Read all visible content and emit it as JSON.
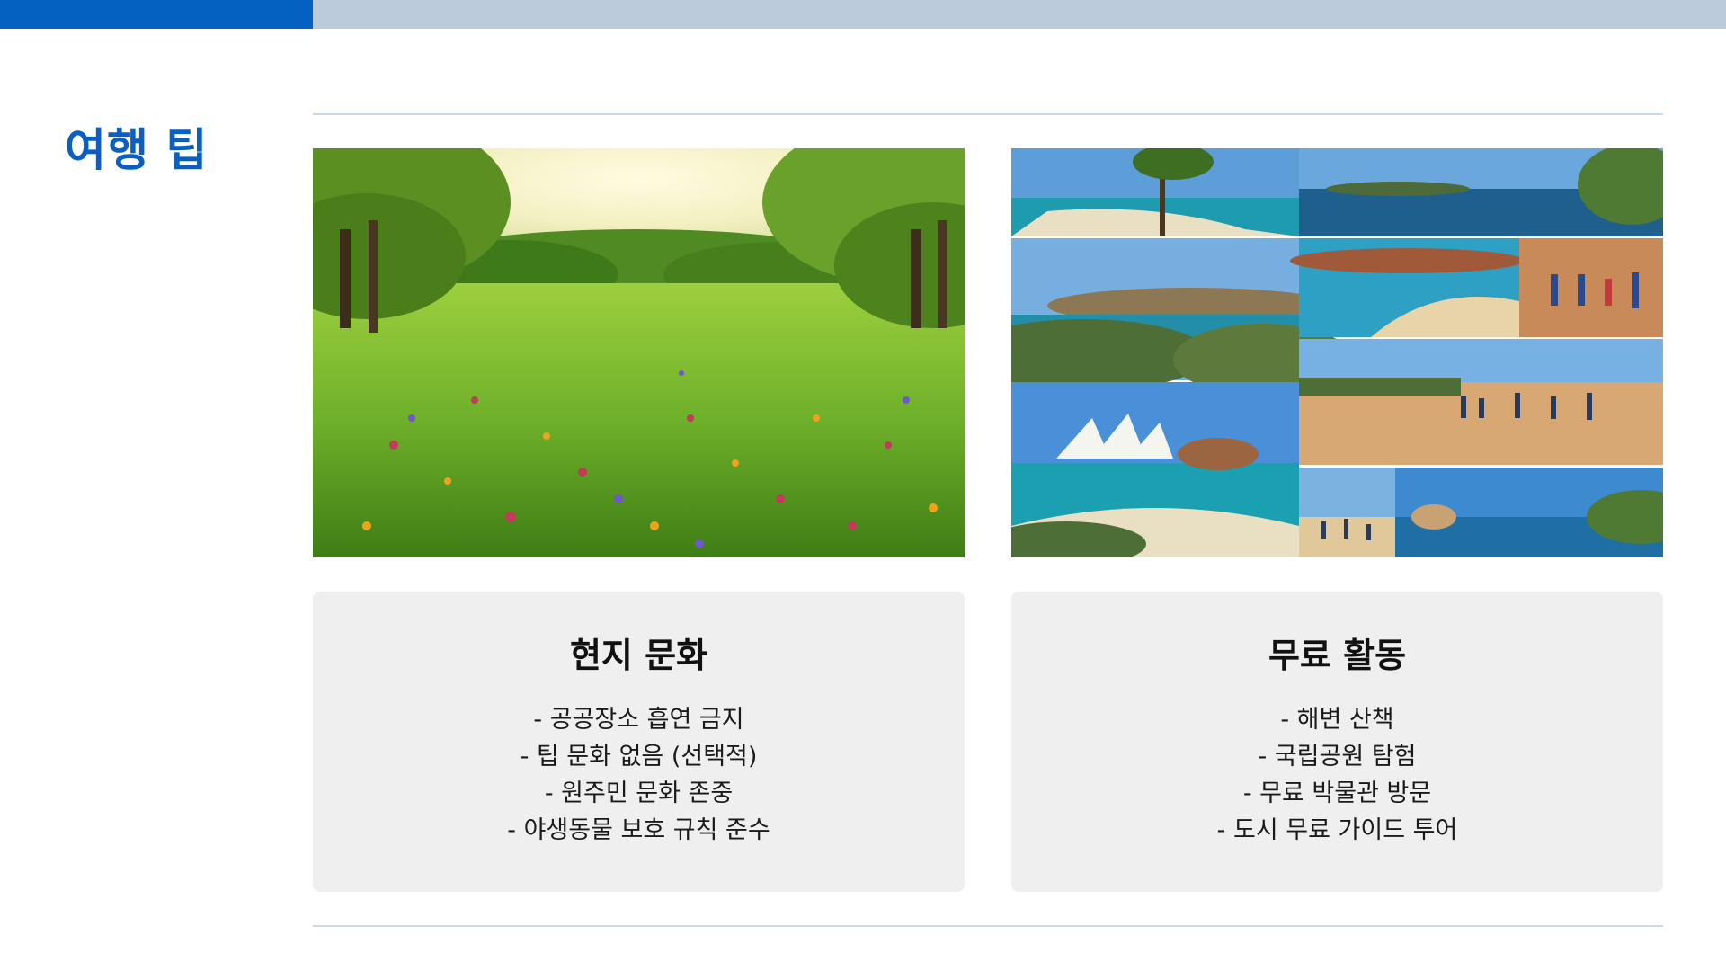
{
  "page": {
    "title": "여행 팁",
    "accent_color": "#0561c1",
    "topbar_color": "#bccbdb"
  },
  "images": {
    "left": "meadow-with-trees-and-wildflowers",
    "right": "collage-of-australian-coast-and-hikers"
  },
  "cards": [
    {
      "title": "현지 문화",
      "items": [
        "- 공공장소 흡연 금지",
        "- 팁 문화 없음 (선택적)",
        "- 원주민 문화 존중",
        "- 야생동물 보호 규칙 준수"
      ]
    },
    {
      "title": "무료 활동",
      "items": [
        "- 해변 산책",
        "- 국립공원 탐험",
        "- 무료 박물관 방문",
        "- 도시 무료 가이드 투어"
      ]
    }
  ]
}
